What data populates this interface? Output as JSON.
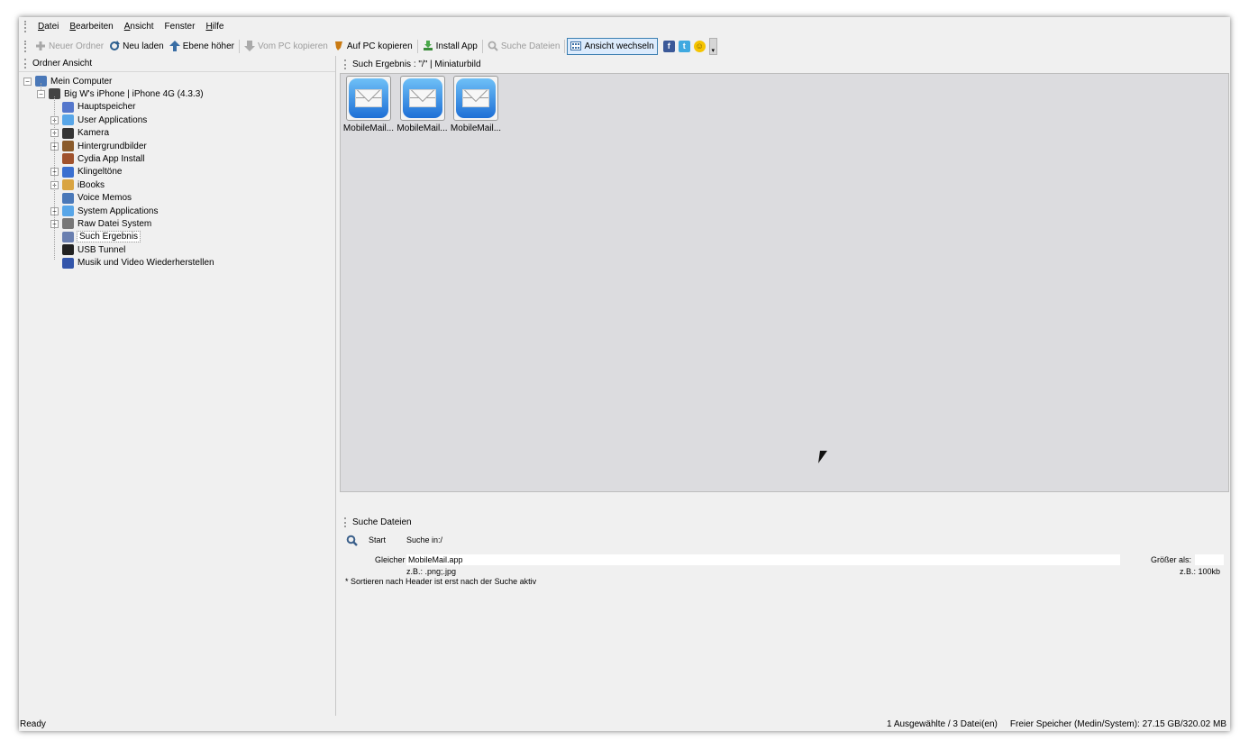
{
  "menu": {
    "items": [
      {
        "underline": "D",
        "rest": "atei"
      },
      {
        "underline": "B",
        "rest": "earbeiten"
      },
      {
        "underline": "A",
        "rest": "nsicht"
      },
      {
        "underline": "",
        "rest": "Fenster"
      },
      {
        "underline": "H",
        "rest": "ilfe"
      }
    ]
  },
  "toolbar": {
    "new_folder": "Neuer Ordner",
    "reload": "Neu laden",
    "level_up": "Ebene höher",
    "copy_from_pc": "Vom PC kopieren",
    "copy_to_pc": "Auf PC kopieren",
    "install_app": "Install App",
    "search_files": "Suche Dateien",
    "switch_view": "Ansicht wechseln",
    "facebook": "f",
    "twitter": "t"
  },
  "left_pane": {
    "title": "Ordner Ansicht",
    "tree": [
      {
        "label": "Mein Computer",
        "level": 0,
        "expander": "-",
        "icon": "computer-icon"
      },
      {
        "label": "Big W's iPhone | iPhone 4G (4.3.3)",
        "level": 1,
        "expander": "-",
        "icon": "iphone-icon"
      },
      {
        "label": "Hauptspeicher",
        "level": 2,
        "expander": "",
        "icon": "storage-icon"
      },
      {
        "label": "User Applications",
        "level": 2,
        "expander": "+",
        "icon": "apps-icon"
      },
      {
        "label": "Kamera",
        "level": 2,
        "expander": "+",
        "icon": "camera-icon"
      },
      {
        "label": "Hintergrundbilder",
        "level": 2,
        "expander": "+",
        "icon": "wallpaper-icon"
      },
      {
        "label": "Cydia App Install",
        "level": 2,
        "expander": "",
        "icon": "cydia-icon"
      },
      {
        "label": "Klingeltöne",
        "level": 2,
        "expander": "+",
        "icon": "ringtone-icon"
      },
      {
        "label": "iBooks",
        "level": 2,
        "expander": "+",
        "icon": "ibooks-icon"
      },
      {
        "label": "Voice Memos",
        "level": 2,
        "expander": "",
        "icon": "voice-memo-icon"
      },
      {
        "label": "System Applications",
        "level": 2,
        "expander": "+",
        "icon": "system-apps-icon"
      },
      {
        "label": "Raw Datei System",
        "level": 2,
        "expander": "+",
        "icon": "raw-filesystem-icon"
      },
      {
        "label": "Such Ergebnis",
        "level": 2,
        "expander": "",
        "icon": "search-result-icon",
        "selected": true
      },
      {
        "label": "USB Tunnel",
        "level": 2,
        "expander": "",
        "icon": "usb-tunnel-icon"
      },
      {
        "label": "Musik und Video Wiederherstellen",
        "level": 2,
        "expander": "",
        "icon": "media-restore-icon"
      }
    ]
  },
  "results": {
    "title": "Such Ergebnis : \"/\"  |  Miniaturbild",
    "items": [
      {
        "label": "MobileMail...",
        "icon": "mail-app-icon"
      },
      {
        "label": "MobileMail...",
        "icon": "mail-app-icon"
      },
      {
        "label": "MobileMail...",
        "icon": "mail-app-icon"
      }
    ]
  },
  "search_panel": {
    "title": "Suche Dateien",
    "start_label": "Start",
    "search_in": "Suche in:/",
    "match_label": "Gleicher",
    "match_value": "MobileMail.app",
    "match_example": "z.B.:  .png;.jpg",
    "size_label": "Größer als:",
    "size_value": "",
    "size_example": "z.B.:  100kb",
    "note": "* Sortieren nach Header ist erst nach der Suche aktiv"
  },
  "status": {
    "ready": "Ready",
    "selection": "1 Ausgewählte / 3 Datei(en)",
    "free_space": "Freier Speicher (Medin/System): 27.15 GB/320.02 MB"
  },
  "colors": {
    "accent": "#3c7fb1",
    "results_bg": "#dcdcdf",
    "window_bg": "#f0f0f0"
  }
}
